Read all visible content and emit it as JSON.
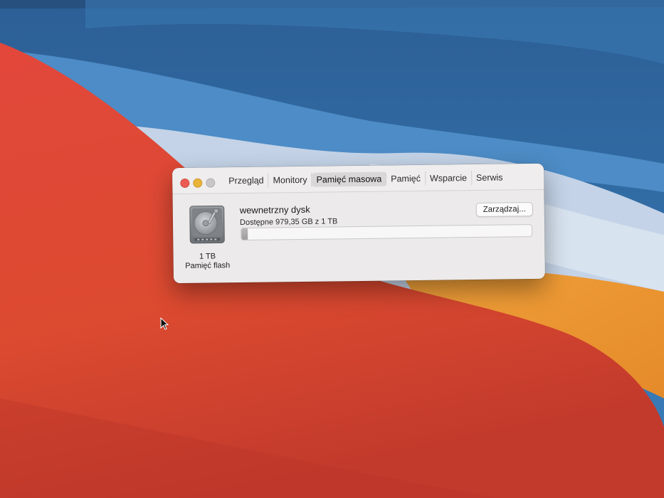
{
  "window": {
    "tabs": [
      {
        "label": "Przegląd"
      },
      {
        "label": "Monitory"
      },
      {
        "label": "Pamięć masowa"
      },
      {
        "label": "Pamięć"
      },
      {
        "label": "Wsparcie"
      },
      {
        "label": "Serwis"
      }
    ],
    "active_tab": "Pamięć masowa"
  },
  "disk": {
    "icon": "hard-drive-icon",
    "size": "1 TB",
    "type": "Pamięć flash",
    "name": "wewnetrzny dysk",
    "available": "Dostępne 979,35 GB z 1 TB",
    "manage_label": "Zarządzaj...",
    "used_fraction": 0.021
  },
  "colors": {
    "close": "#ec5b52",
    "minimize": "#e9b43a",
    "maximize": "#c8c6c6"
  }
}
